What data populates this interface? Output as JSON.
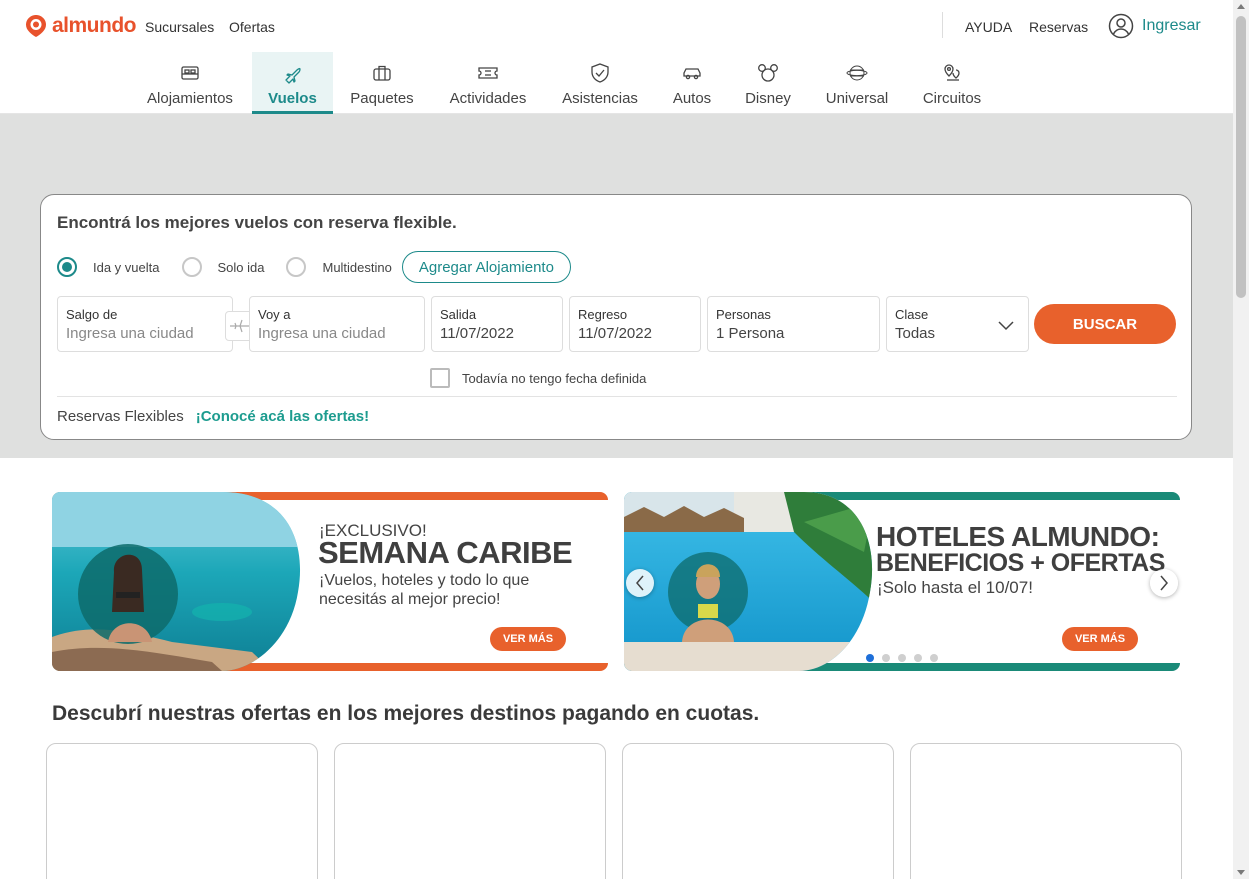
{
  "brand": {
    "name": "almundo",
    "color": "#e8522c",
    "accent": "#1d8a8a"
  },
  "header": {
    "links": [
      "Sucursales",
      "Ofertas"
    ],
    "help": "AYUDA",
    "bookings": "Reservas",
    "login": "Ingresar"
  },
  "nav": {
    "items": [
      {
        "label": "Alojamientos",
        "icon": "bed-icon"
      },
      {
        "label": "Vuelos",
        "icon": "airplane-icon",
        "active": true
      },
      {
        "label": "Paquetes",
        "icon": "suitcase-icon"
      },
      {
        "label": "Actividades",
        "icon": "ticket-icon"
      },
      {
        "label": "Asistencias",
        "icon": "shield-icon"
      },
      {
        "label": "Autos",
        "icon": "car-icon"
      },
      {
        "label": "Disney",
        "icon": "mickey-icon"
      },
      {
        "label": "Universal",
        "icon": "universal-globe-icon"
      },
      {
        "label": "Circuitos",
        "icon": "map-pin-icon"
      }
    ]
  },
  "search": {
    "title": "Encontrá los mejores vuelos con reserva flexible.",
    "trip_types": [
      {
        "label": "Ida y vuelta",
        "checked": true
      },
      {
        "label": "Solo ida",
        "checked": false
      },
      {
        "label": "Multidestino",
        "checked": false
      }
    ],
    "add_lodging": "Agregar Alojamiento",
    "origin": {
      "label": "Salgo de",
      "placeholder": "Ingresa una ciudad"
    },
    "destination": {
      "label": "Voy a",
      "placeholder": "Ingresa una ciudad"
    },
    "departure": {
      "label": "Salida",
      "value": "11/07/2022"
    },
    "return": {
      "label": "Regreso",
      "value": "11/07/2022"
    },
    "passengers": {
      "label": "Personas",
      "value": "1 Persona"
    },
    "cabin": {
      "label": "Clase",
      "value": "Todas"
    },
    "submit": "BUSCAR",
    "no_date": "Todavía no tengo fecha definida",
    "flexible_label": "Reservas Flexibles",
    "flexible_link": "¡Conocé acá las ofertas!"
  },
  "banners": [
    {
      "kicker": "¡EXCLUSIVO!",
      "title": "SEMANA CARIBE",
      "subtitle_1": "¡Vuelos, hoteles y todo lo que",
      "subtitle_2": "necesitás al mejor precio!",
      "cta": "VER MÁS",
      "color": "#e8612c"
    },
    {
      "title_1": "HOTELES ALMUNDO:",
      "title_2": "BENEFICIOS + OFERTAS",
      "subtitle": "¡Solo hasta el 10/07!",
      "cta": "VER MÁS",
      "color": "#1a8a78"
    }
  ],
  "carousel": {
    "total_slides": 5,
    "active_slide": 1
  },
  "offers": {
    "title": "Descubrí nuestras ofertas en los mejores destinos pagando en cuotas."
  }
}
